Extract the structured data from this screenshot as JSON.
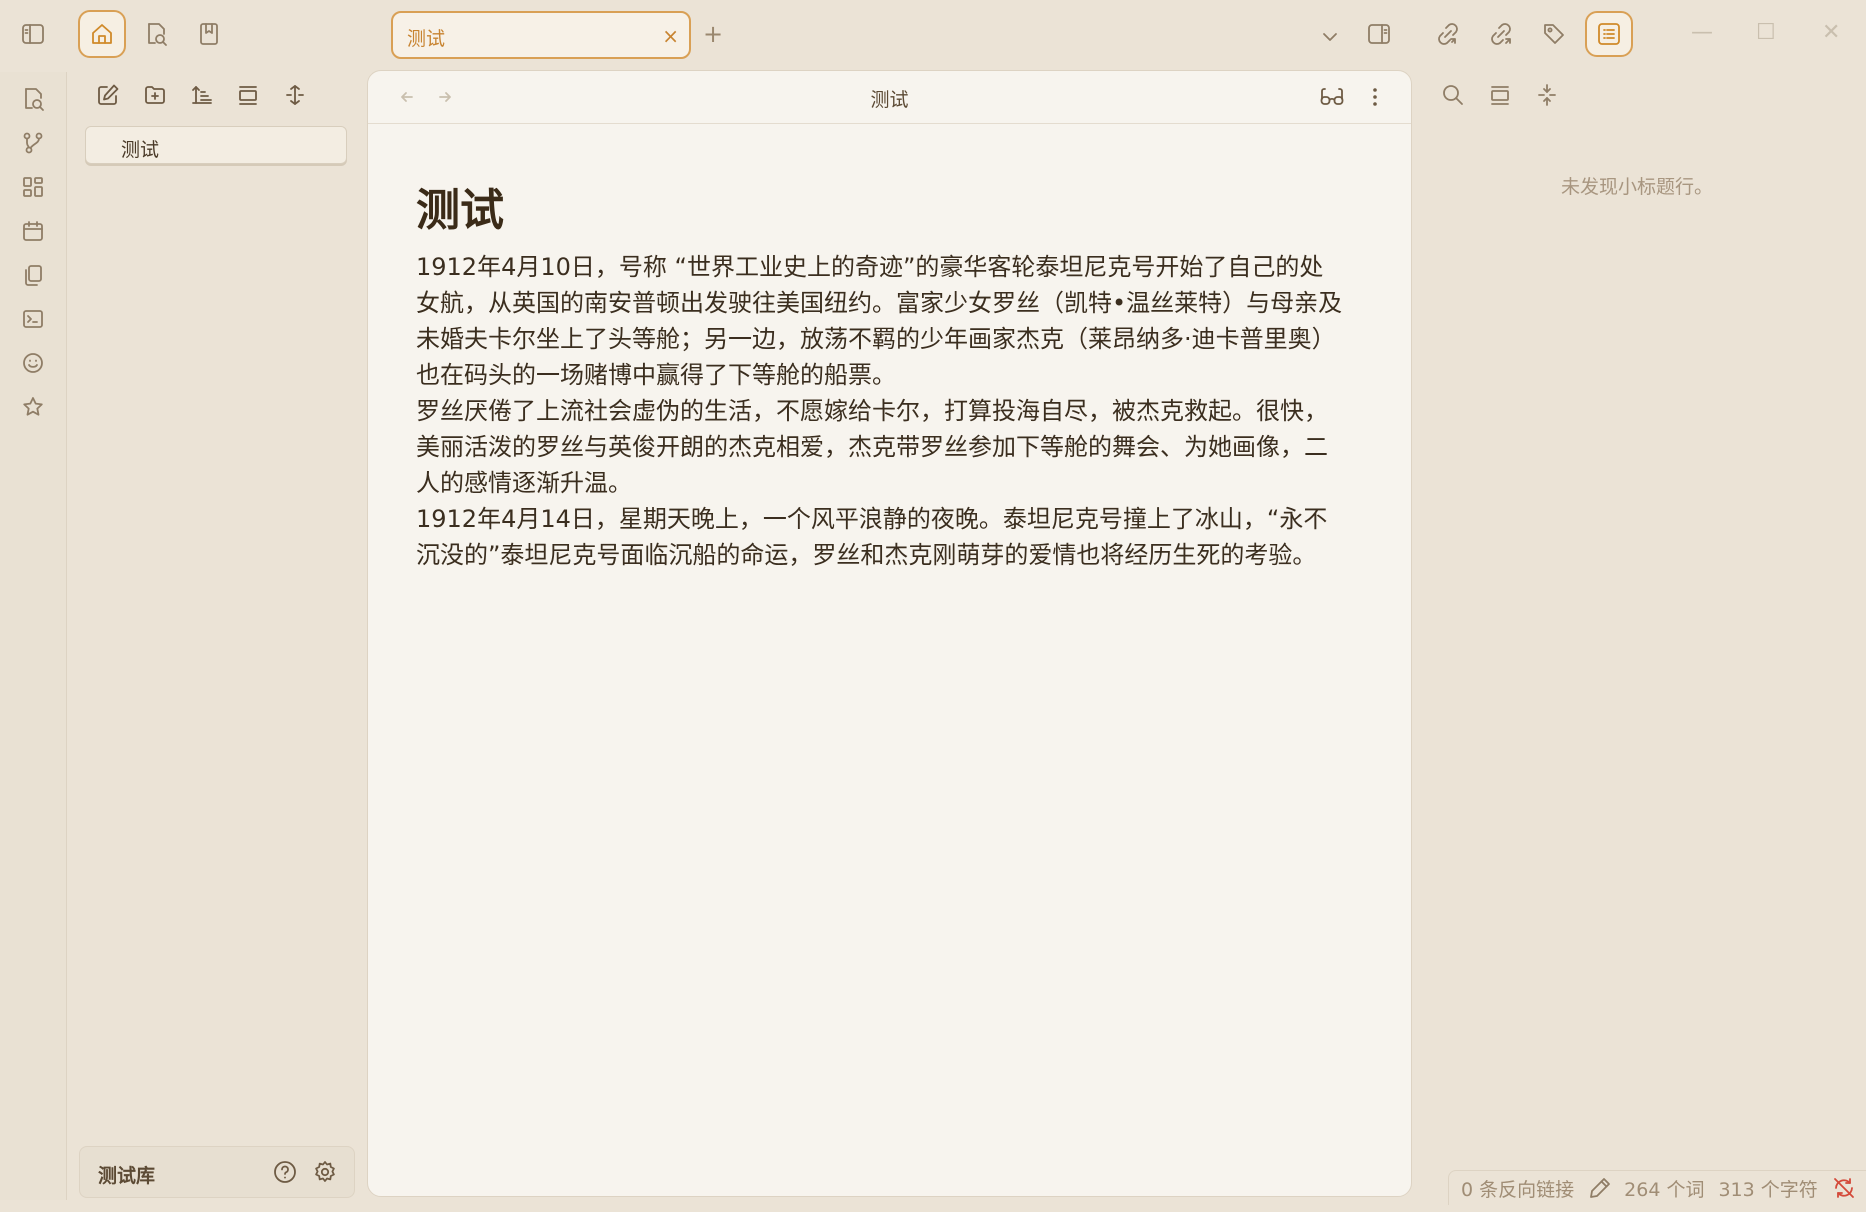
{
  "tabs": [
    {
      "label": "测试",
      "close": "×"
    }
  ],
  "new_tab_label": "+",
  "explorer": {
    "files": [
      {
        "label": "测试"
      }
    ],
    "vault_name": "测试库"
  },
  "editor": {
    "header_title": "测试",
    "heading": "测试",
    "paragraphs": [
      "1912年4月10日，号称 “世界工业史上的奇迹”的豪华客轮泰坦尼克号开始了自己的处女航，从英国的南安普顿出发驶往美国纽约。富家少女罗丝（凯特•温丝莱特）与母亲及未婚夫卡尔坐上了头等舱；另一边，放荡不羁的少年画家杰克（莱昂纳多·迪卡普里奥）也在码头的一场赌博中赢得了下等舱的船票。",
      "罗丝厌倦了上流社会虚伪的生活，不愿嫁给卡尔，打算投海自尽，被杰克救起。很快，美丽活泼的罗丝与英俊开朗的杰克相爱，杰克带罗丝参加下等舱的舞会、为她画像，二人的感情逐渐升温。",
      "1912年4月14日，星期天晚上，一个风平浪静的夜晚。泰坦尼克号撞上了冰山，“永不沉没的”泰坦尼克号面临沉船的命运，罗丝和杰克刚萌芽的爱情也将经历生死的考验。"
    ]
  },
  "outline": {
    "empty_message": "未发现小标题行。"
  },
  "status": {
    "backlinks": "0 条反向链接",
    "words": "264 个词",
    "chars": "313 个字符"
  },
  "window_controls": {
    "minimize": "—",
    "maximize": "☐",
    "close": "✕"
  },
  "colors": {
    "accent": "#d9a055",
    "background": "#ebe3d6",
    "editor": "#f7f4ee",
    "sync_error": "#d44a3a"
  }
}
